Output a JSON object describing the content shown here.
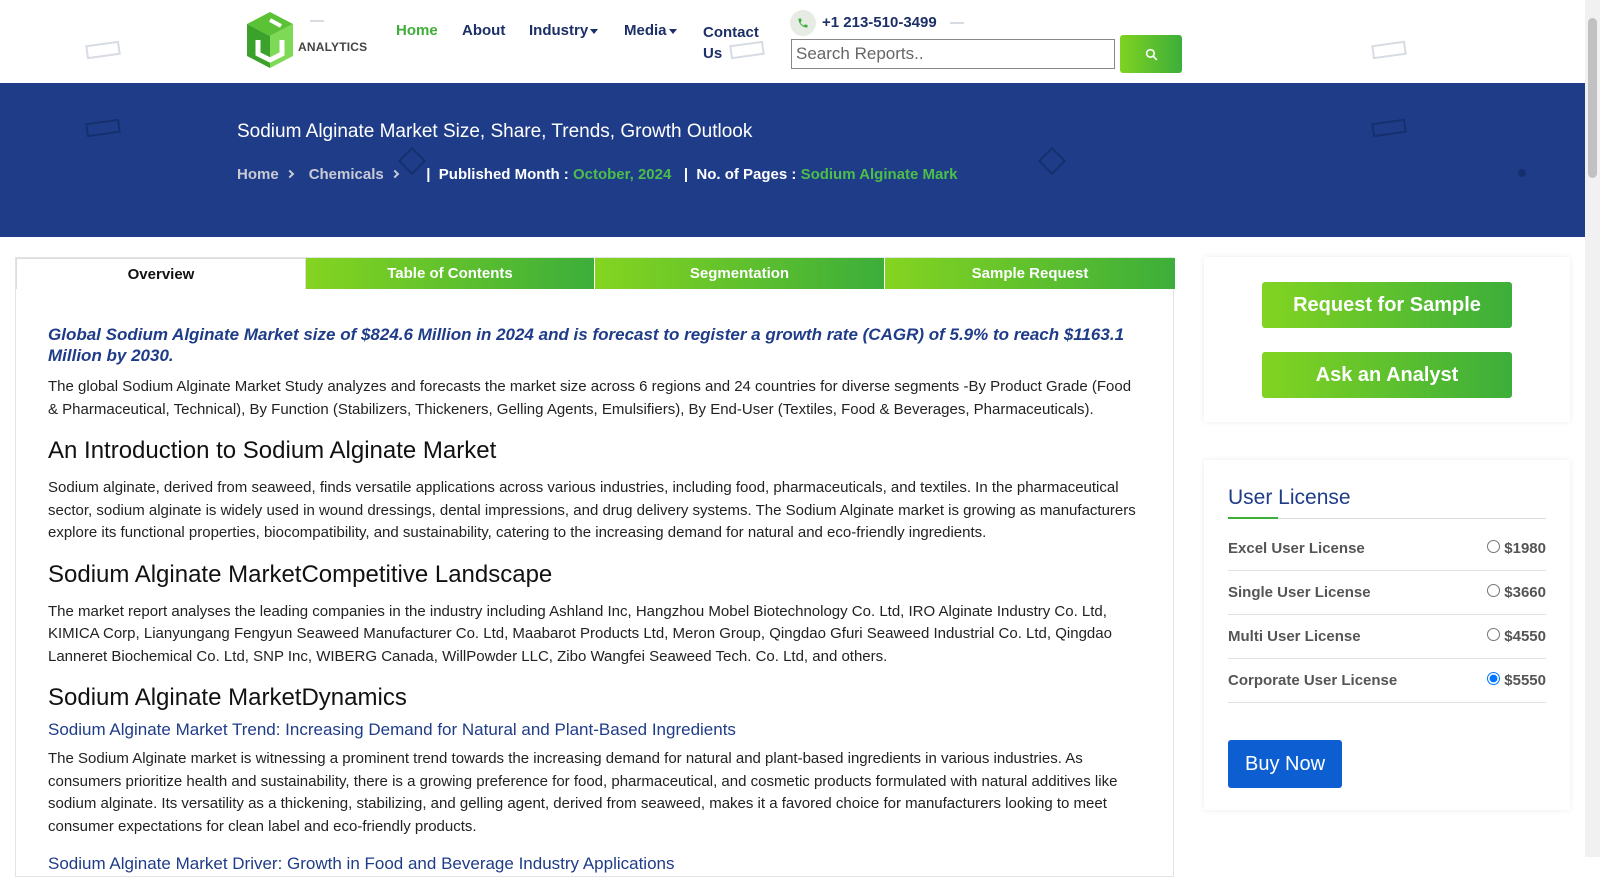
{
  "header": {
    "logo_text": "ANALYTICS",
    "nav": [
      {
        "label": "Home",
        "dropdown": false
      },
      {
        "label": "About",
        "dropdown": false
      },
      {
        "label": "Industry",
        "dropdown": true
      },
      {
        "label": "Media",
        "dropdown": true
      }
    ],
    "contact_label": "Contact Us",
    "phone": "+1 213-510-3499",
    "search_placeholder": "Search Reports..",
    "colors": {
      "navy": "#1f3c88",
      "green": "#3cae3a"
    }
  },
  "banner": {
    "title": "Sodium Alginate Market Size, Share, Trends, Growth Outlook",
    "breadcrumb": [
      "Home",
      "Chemicals"
    ],
    "published_label": "Published Month :",
    "published_value": "October, 2024",
    "pages_label": "No. of Pages :",
    "pages_value": "Sodium Alginate Mark"
  },
  "tabs": [
    "Overview",
    "Table of Contents",
    "Segmentation",
    "Sample Request"
  ],
  "content": {
    "lead": "Global Sodium Alginate Market size of $824.6 Million in 2024 and is forecast to register a growth rate (CAGR) of 5.9% to reach $1163.1 Million by 2030.",
    "lead_body": "The global Sodium Alginate Market Study analyzes and forecasts the market size across 6 regions and 24 countries for diverse segments -By Product Grade (Food & Pharmaceutical, Technical), By Function (Stabilizers, Thickeners, Gelling Agents, Emulsifiers), By End-User (Textiles, Food & Beverages, Pharmaceuticals).",
    "intro_heading": "An Introduction to Sodium Alginate Market",
    "intro_body": "Sodium alginate, derived from seaweed, finds versatile applications across various industries, including food, pharmaceuticals, and textiles. In the pharmaceutical sector, sodium alginate is widely used in wound dressings, dental impressions, and drug delivery systems. The Sodium Alginate market is growing as manufacturers explore its functional properties, biocompatibility, and sustainability, catering to the increasing demand for natural and eco-friendly ingredients.",
    "competitive_heading": "Sodium Alginate MarketCompetitive Landscape",
    "competitive_body": "The market report analyses the leading companies in the industry including Ashland Inc, Hangzhou Mobel Biotechnology Co. Ltd, IRO Alginate Industry Co. Ltd, KIMICA Corp, Lianyungang Fengyun Seaweed Manufacturer Co. Ltd, Maabarot Products Ltd, Meron Group, Qingdao Gfuri Seaweed Industrial Co. Ltd, Qingdao Lanneret Biochemical Co. Ltd, SNP Inc, WIBERG Canada, WillPowder LLC, Zibo Wangfei Seaweed Tech. Co. Ltd, and others.",
    "dynamics_heading": "Sodium Alginate MarketDynamics",
    "trend_heading": "Sodium Alginate Market Trend: Increasing Demand for Natural and Plant-Based Ingredients",
    "trend_body": "The Sodium Alginate market is witnessing a prominent trend towards the increasing demand for natural and plant-based ingredients in various industries. As consumers prioritize health and sustainability, there is a growing preference for food, pharmaceutical, and cosmetic products formulated with natural additives like sodium alginate. Its versatility as a thickening, stabilizing, and gelling agent, derived from seaweed, makes it a favored choice for manufacturers looking to meet consumer expectations for clean label and eco-friendly products.",
    "driver_heading": "Sodium Alginate Market Driver: Growth in Food and Beverage Industry Applications"
  },
  "sidebar": {
    "request_sample": "Request for Sample",
    "ask_analyst": "Ask an Analyst",
    "license_title": "User License",
    "licenses": [
      {
        "name": "Excel User License",
        "price": "$1980",
        "selected": false
      },
      {
        "name": "Single User License",
        "price": "$3660",
        "selected": false
      },
      {
        "name": "Multi User License",
        "price": "$4550",
        "selected": false
      },
      {
        "name": "Corporate User License",
        "price": "$5550",
        "selected": true
      }
    ],
    "buy_now": "Buy Now"
  }
}
